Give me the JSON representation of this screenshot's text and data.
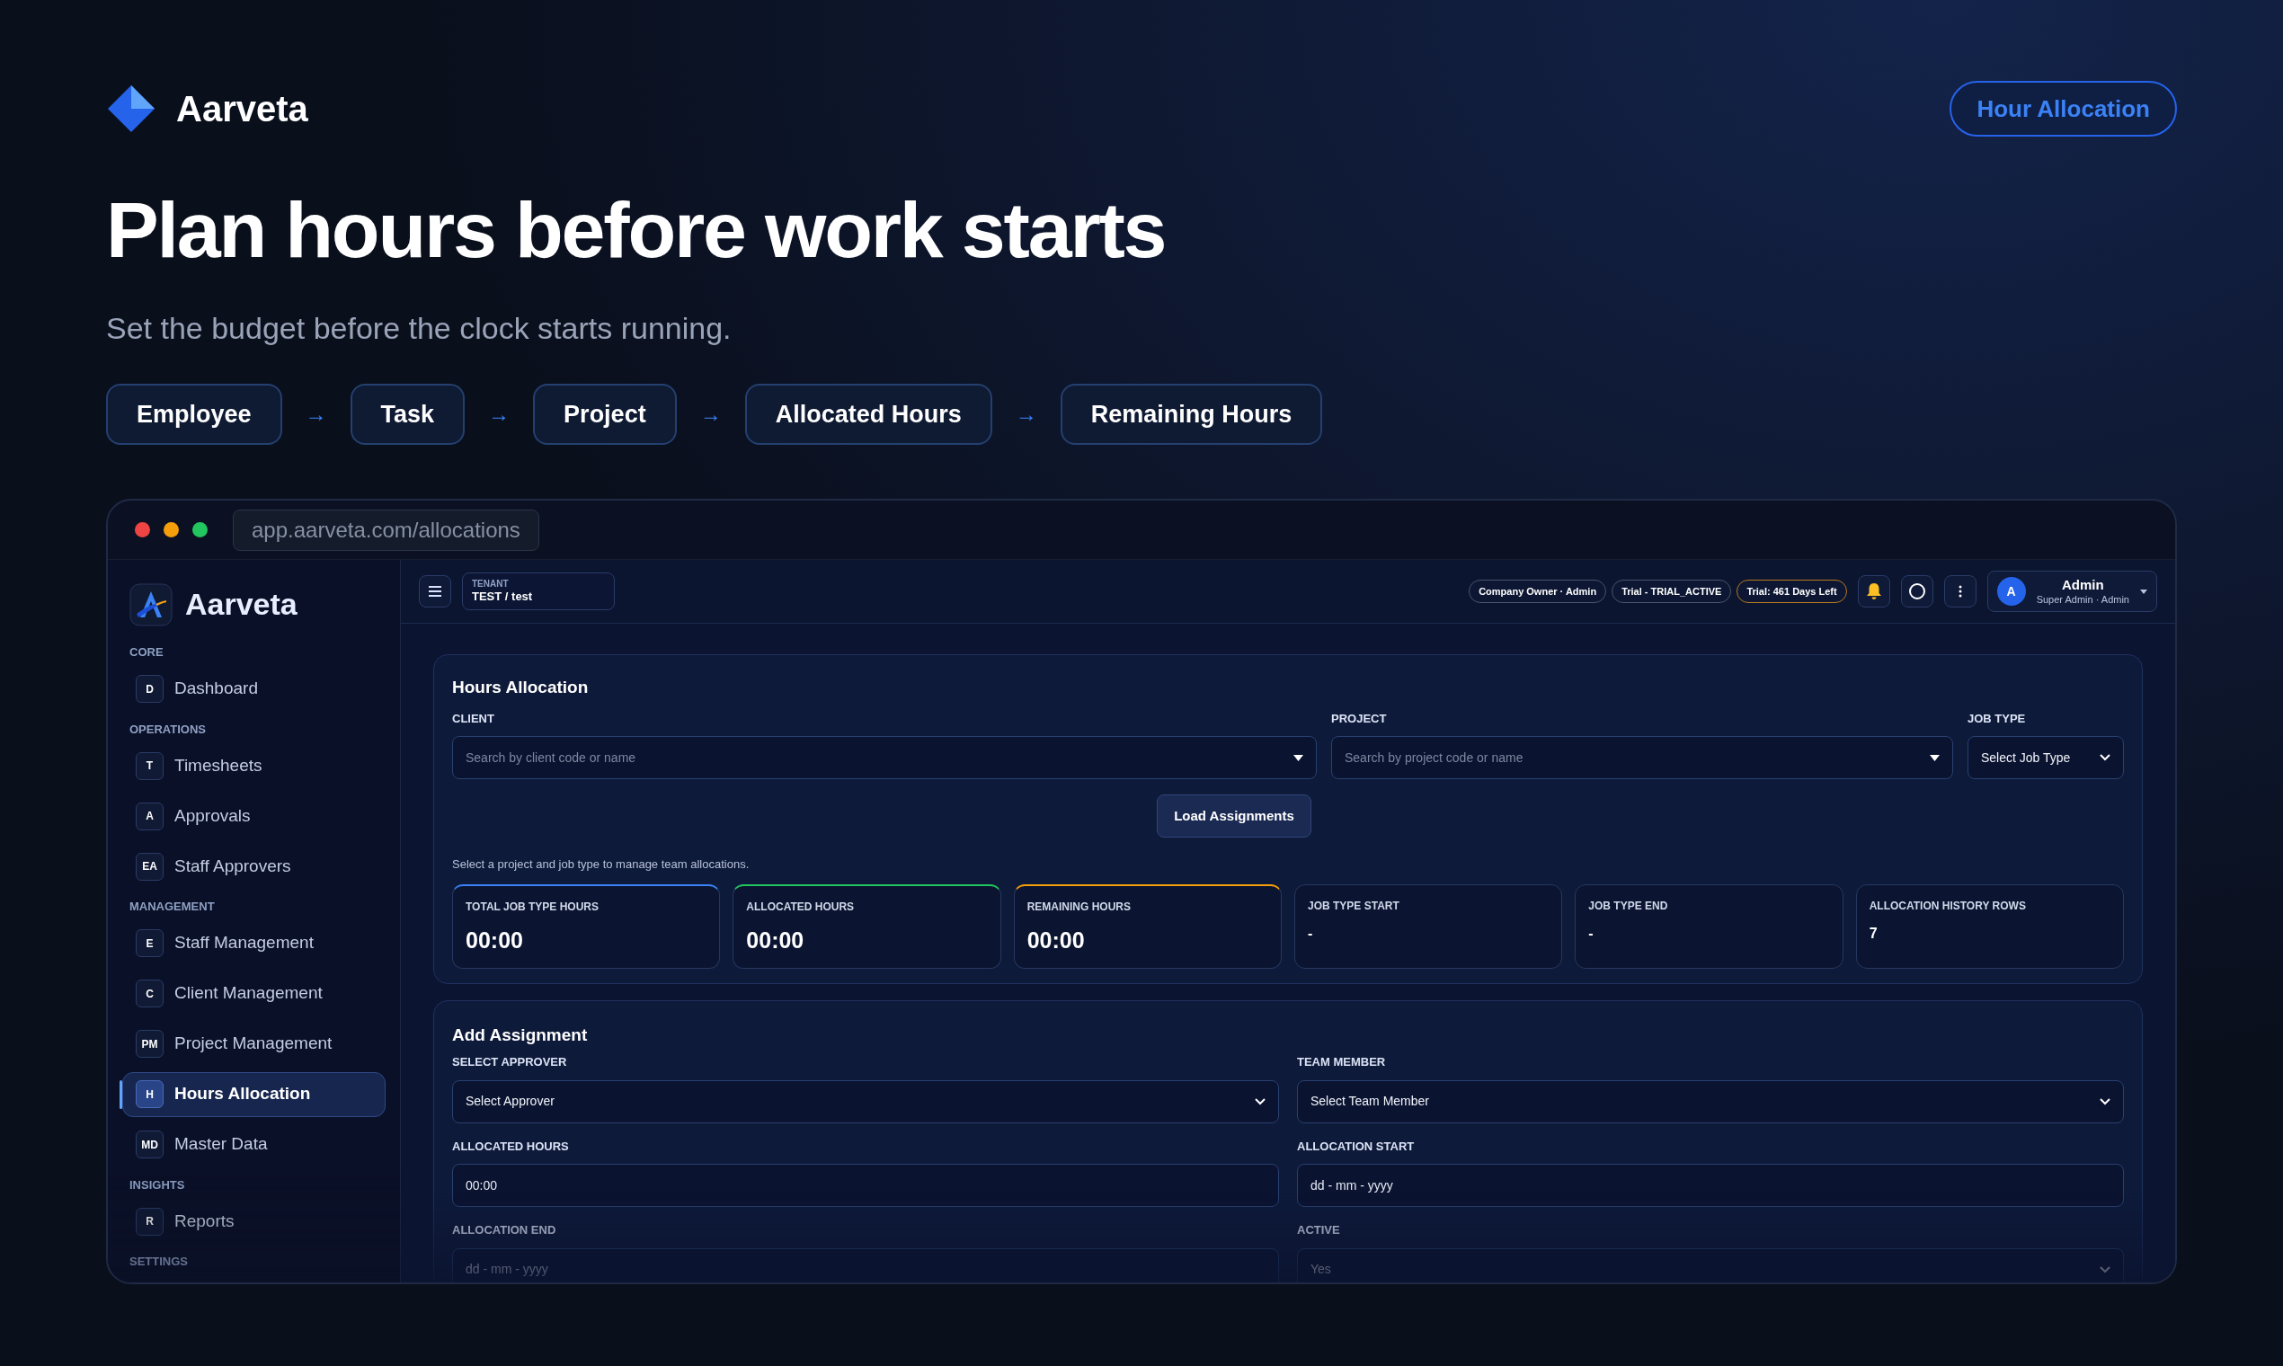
{
  "brand": {
    "name": "Aarveta"
  },
  "header_button": "Hour Allocation",
  "headline": "Plan hours before work starts",
  "subtitle": "Set the budget before the clock starts running.",
  "flow": [
    {
      "kind": "step",
      "label": "Employee"
    },
    {
      "kind": "arrow",
      "label": "→"
    },
    {
      "kind": "step",
      "label": "Task"
    },
    {
      "kind": "arrow",
      "label": "→"
    },
    {
      "kind": "step",
      "label": "Project"
    },
    {
      "kind": "arrow",
      "label": "→"
    },
    {
      "kind": "step",
      "label": "Allocated Hours"
    },
    {
      "kind": "arrow",
      "label": "→"
    },
    {
      "kind": "step",
      "label": "Remaining Hours"
    }
  ],
  "browser": {
    "url": "app.aarveta.com/allocations"
  },
  "sidebar": {
    "brand": "Aarveta",
    "sections": [
      {
        "title": "CORE",
        "items": [
          {
            "badge": "D",
            "label": "Dashboard",
            "selected": false
          }
        ]
      },
      {
        "title": "OPERATIONS",
        "items": [
          {
            "badge": "T",
            "label": "Timesheets",
            "selected": false
          },
          {
            "badge": "A",
            "label": "Approvals",
            "selected": false
          },
          {
            "badge": "EA",
            "label": "Staff Approvers",
            "selected": false
          }
        ]
      },
      {
        "title": "MANAGEMENT",
        "items": [
          {
            "badge": "E",
            "label": "Staff Management",
            "selected": false
          },
          {
            "badge": "C",
            "label": "Client Management",
            "selected": false
          },
          {
            "badge": "PM",
            "label": "Project Management",
            "selected": false
          },
          {
            "badge": "H",
            "label": "Hours Allocation",
            "selected": true
          },
          {
            "badge": "MD",
            "label": "Master Data",
            "selected": false
          }
        ]
      },
      {
        "title": "INSIGHTS",
        "items": [
          {
            "badge": "R",
            "label": "Reports",
            "selected": false
          }
        ]
      },
      {
        "title": "SETTINGS"
      }
    ]
  },
  "topbar": {
    "tenant_label": "TENANT",
    "tenant_value": "TEST / test",
    "badges": [
      {
        "label": "Company Owner · Admin",
        "color": "#475569"
      },
      {
        "label": "Trial - TRIAL_ACTIVE",
        "color": "#475569"
      },
      {
        "label": "Trial: 461 Days Left",
        "color": "#b7791f"
      }
    ],
    "user": {
      "avatar": "A",
      "name": "Admin",
      "role": "Super Admin · Admin"
    }
  },
  "hours_allocation": {
    "title": "Hours Allocation",
    "fields": [
      {
        "kind": "combo",
        "label": "CLIENT",
        "placeholder": "Search by client code or name"
      },
      {
        "kind": "combo",
        "label": "PROJECT",
        "placeholder": "Search by project code or name"
      },
      {
        "kind": "select",
        "label": "JOB TYPE",
        "value": "Select Job Type"
      }
    ],
    "button": "Load Assignments",
    "hint": "Select a project and job type to manage team allocations.",
    "stats": [
      {
        "label": "TOTAL JOB TYPE HOURS",
        "value": "00:00",
        "color": "#3b82f6"
      },
      {
        "label": "ALLOCATED HOURS",
        "value": "00:00",
        "color": "#22c55e"
      },
      {
        "label": "REMAINING HOURS",
        "value": "00:00",
        "color": "#f59e0b"
      },
      {
        "label": "JOB TYPE START",
        "value": "-"
      },
      {
        "label": "JOB TYPE END",
        "value": "-"
      },
      {
        "label": "ALLOCATION HISTORY ROWS",
        "value": "7"
      }
    ]
  },
  "add_assignment": {
    "title": "Add Assignment",
    "fields": [
      {
        "kind": "select",
        "label": "SELECT APPROVER",
        "value": "Select Approver"
      },
      {
        "kind": "select",
        "label": "TEAM MEMBER",
        "value": "Select Team Member"
      },
      {
        "kind": "input",
        "label": "ALLOCATED HOURS",
        "value": "00:00"
      },
      {
        "kind": "input",
        "label": "ALLOCATION START",
        "value": "dd - mm - yyyy"
      },
      {
        "kind": "input",
        "label": "ALLOCATION END",
        "value": "dd - mm - yyyy"
      },
      {
        "kind": "select",
        "label": "ACTIVE",
        "value": "Yes"
      }
    ]
  }
}
